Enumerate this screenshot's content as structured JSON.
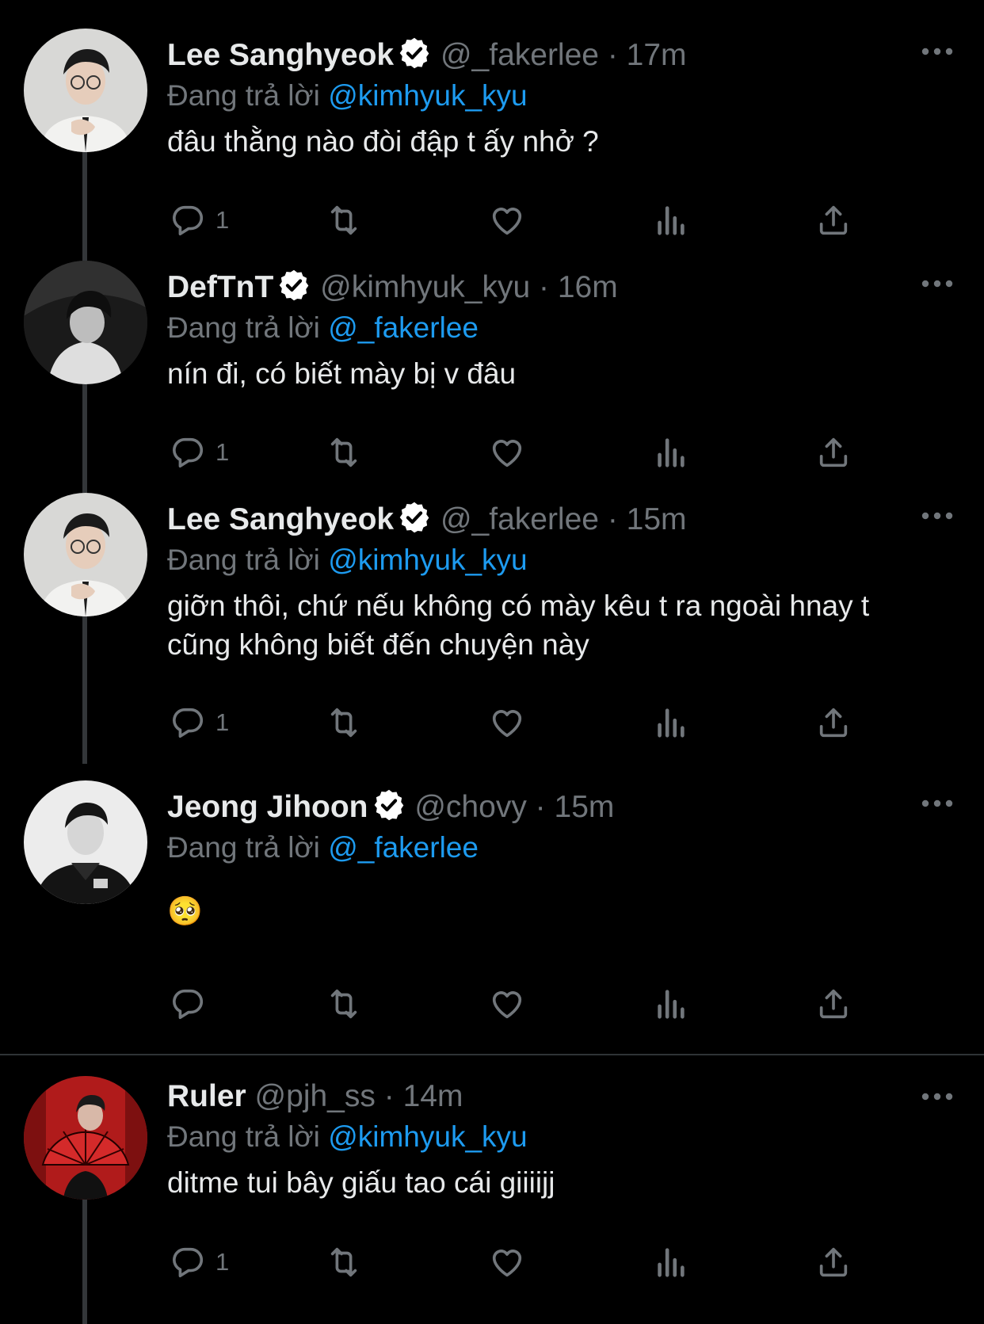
{
  "colors": {
    "background": "#000000",
    "text": "#e7e9ea",
    "muted": "#71767b",
    "link": "#1d9bf0",
    "verified": "#ffffff"
  },
  "reply_prefix": "Đang trả lời",
  "tweets": [
    {
      "name": "Lee Sanghyeok",
      "verified": true,
      "handle": "@_fakerlee",
      "time": "17m",
      "reply_to": "@kimhyuk_kyu",
      "text": "đâu thằng nào đòi đập t ấy nhở ?",
      "reply_count": "1"
    },
    {
      "name": "DefTnT",
      "verified": true,
      "handle": "@kimhyuk_kyu",
      "time": "16m",
      "reply_to": "@_fakerlee",
      "text": "nín đi, có biết mày bị v đâu",
      "reply_count": "1"
    },
    {
      "name": "Lee Sanghyeok",
      "verified": true,
      "handle": "@_fakerlee",
      "time": "15m",
      "reply_to": "@kimhyuk_kyu",
      "text": "giỡn thôi, chứ nếu không có mày kêu t ra ngoài hnay t cũng không biết đến chuyện này",
      "reply_count": "1"
    },
    {
      "name": "Jeong Jihoon",
      "verified": true,
      "handle": "@chovy",
      "time": "15m",
      "reply_to": "@_fakerlee",
      "text": "🥺",
      "reply_count": ""
    },
    {
      "name": "Ruler",
      "verified": false,
      "handle": "@pjh_ss",
      "time": "14m",
      "reply_to": "@kimhyuk_kyu",
      "text": "ditme tui bây giấu tao cái giiiijj",
      "reply_count": "1"
    }
  ],
  "action_icons": [
    "reply-icon",
    "retweet-icon",
    "like-icon",
    "views-icon",
    "share-icon"
  ],
  "more_icon": "more-options-icon"
}
